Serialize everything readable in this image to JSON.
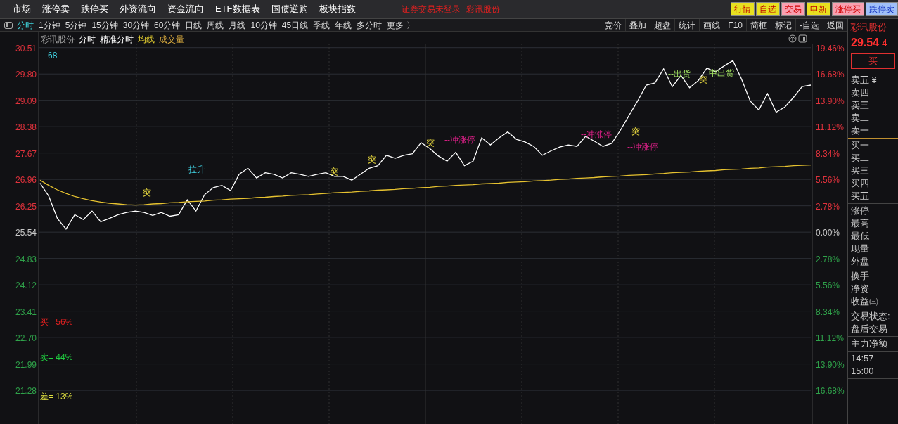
{
  "menu_bar": {
    "items": [
      "市场",
      "涨停卖",
      "跌停买",
      "外资流向",
      "资金流向",
      "ETF数据表",
      "国债逆购",
      "板块指数"
    ],
    "status_texts": [
      "证券交易未登录",
      "彩讯股份"
    ],
    "quick_buttons": [
      {
        "label": "行情",
        "kind": "yellow"
      },
      {
        "label": "自选",
        "kind": "yellow"
      },
      {
        "label": "交易",
        "kind": "pink"
      },
      {
        "label": "申新",
        "kind": "yellow"
      },
      {
        "label": "涨停买",
        "kind": "pink"
      },
      {
        "label": "跌停卖",
        "kind": "blue"
      }
    ]
  },
  "toolbar": {
    "periods": [
      {
        "label": "分时",
        "selected": true
      },
      {
        "label": "1分钟",
        "selected": false
      },
      {
        "label": "5分钟",
        "selected": false
      },
      {
        "label": "15分钟",
        "selected": false
      },
      {
        "label": "30分钟",
        "selected": false
      },
      {
        "label": "60分钟",
        "selected": false
      },
      {
        "label": "日线",
        "selected": false
      },
      {
        "label": "周线",
        "selected": false
      },
      {
        "label": "月线",
        "selected": false
      },
      {
        "label": "10分钟",
        "selected": false
      },
      {
        "label": "45日线",
        "selected": false
      },
      {
        "label": "季线",
        "selected": false
      },
      {
        "label": "年线",
        "selected": false
      },
      {
        "label": "多分时",
        "selected": false
      },
      {
        "label": "更多 〉",
        "selected": false
      }
    ],
    "tools": [
      "竞价",
      "叠加",
      "超盘",
      "统计",
      "画线",
      "F10",
      "简框",
      "标记",
      "-自选",
      "返回"
    ]
  },
  "chart": {
    "stock_name": "彩讯股份",
    "header_extras": [
      "精准分时",
      "成交量"
    ],
    "indicator_value": "68",
    "right_labels": [
      "19.46%",
      "16.68%",
      "13.90%",
      "11.12%",
      "8.34%",
      "5.56%",
      "2.78%",
      "0.00%",
      "2.78%",
      "5.56%",
      "8.34%",
      "11.12%",
      "13.90%",
      "16.68%"
    ],
    "stats": [
      {
        "text": "买= 56%",
        "kind": "buy"
      },
      {
        "text": "卖= 44%",
        "kind": "sell"
      },
      {
        "text": "差= 13%",
        "kind": "diff"
      }
    ],
    "markers": [
      {
        "text": "突",
        "kind": "breakout"
      },
      {
        "text": "拉升",
        "kind": "pull"
      },
      {
        "text": "突",
        "kind": "breakout"
      },
      {
        "text": "突",
        "kind": "breakout"
      },
      {
        "text": "突",
        "kind": "breakout"
      },
      {
        "text": "--冲涨停",
        "kind": "limit"
      },
      {
        "text": "--冲涨停",
        "kind": "limit"
      },
      {
        "text": "--冲涨停",
        "kind": "limit"
      },
      {
        "text": "突",
        "kind": "breakout"
      },
      {
        "text": "--出货",
        "kind": "sell"
      },
      {
        "text": "突",
        "kind": "breakout"
      },
      {
        "text": "中出货",
        "kind": "sell"
      }
    ],
    "chart_data": {
      "type": "line",
      "ylim": [
        20.43,
        30.94
      ],
      "grid": true,
      "categories": [
        null,
        null,
        null,
        null,
        null,
        null,
        null,
        null,
        null,
        null,
        null,
        null,
        null,
        null,
        null,
        null,
        null,
        null,
        null,
        null,
        null,
        null,
        null,
        null,
        null,
        null,
        null,
        null,
        null,
        null,
        null,
        null,
        null,
        null,
        null,
        null,
        null,
        null,
        null,
        null,
        null,
        null,
        null,
        null,
        null,
        null,
        null,
        null,
        null,
        null,
        null,
        null,
        null,
        null,
        null,
        null,
        null,
        null,
        null,
        null,
        null,
        null,
        null,
        null,
        null,
        null,
        null,
        null,
        null,
        null,
        null,
        null,
        null,
        null,
        null,
        null,
        null,
        null,
        null,
        null,
        null,
        null,
        null,
        null,
        null,
        null,
        null,
        null,
        null,
        null
      ],
      "yticks": [
        {
          "value": 30.51,
          "label": "30.51"
        },
        {
          "value": 29.8,
          "label": "29.80"
        },
        {
          "value": 29.09,
          "label": "29.09"
        },
        {
          "value": 28.38,
          "label": "28.38"
        },
        {
          "value": 27.67,
          "label": "27.67"
        },
        {
          "value": 26.96,
          "label": "26.96"
        },
        {
          "value": 26.25,
          "label": "26.25"
        },
        {
          "value": 25.54,
          "label": "25.54"
        },
        {
          "value": 24.83,
          "label": "24.83"
        },
        {
          "value": 24.12,
          "label": "24.12"
        },
        {
          "value": 23.41,
          "label": "23.41"
        },
        {
          "value": 22.7,
          "label": "22.70"
        },
        {
          "value": 21.99,
          "label": "21.99"
        },
        {
          "value": 21.28,
          "label": "21.28"
        }
      ],
      "series": [
        {
          "name": "分时",
          "color": "#ffffff",
          "values": [
            26.86,
            26.51,
            25.91,
            25.62,
            26.01,
            25.88,
            26.11,
            25.82,
            25.91,
            26.01,
            26.07,
            26.11,
            26.07,
            25.99,
            26.07,
            25.97,
            26.01,
            26.41,
            26.11,
            26.55,
            26.74,
            26.8,
            26.66,
            27.1,
            27.26,
            27.0,
            27.14,
            27.1,
            27.0,
            27.14,
            27.1,
            27.04,
            27.1,
            27.14,
            27.04,
            27.04,
            26.94,
            27.1,
            27.26,
            27.33,
            27.61,
            27.53,
            27.61,
            27.65,
            27.95,
            27.79,
            27.59,
            27.45,
            27.69,
            27.33,
            27.45,
            28.08,
            27.89,
            28.08,
            28.24,
            28.04,
            27.97,
            27.85,
            27.61,
            27.73,
            27.83,
            27.89,
            27.85,
            28.12,
            27.99,
            27.85,
            27.93,
            28.28,
            28.68,
            29.07,
            29.5,
            29.56,
            29.94,
            29.46,
            29.76,
            29.43,
            29.62,
            29.96,
            29.86,
            30.02,
            30.16,
            29.66,
            29.07,
            28.83,
            29.27,
            28.77,
            28.91,
            29.17,
            29.46,
            29.5
          ]
        },
        {
          "name": "均线",
          "color": "#e6c230",
          "values": [
            26.94,
            26.8,
            26.68,
            26.58,
            26.5,
            26.44,
            26.39,
            26.35,
            26.32,
            26.3,
            26.28,
            26.27,
            26.28,
            26.3,
            26.31,
            26.33,
            26.34,
            26.36,
            26.37,
            26.38,
            26.4,
            26.41,
            26.43,
            26.44,
            26.45,
            26.47,
            26.48,
            26.5,
            26.51,
            26.53,
            26.54,
            26.55,
            26.57,
            26.58,
            26.6,
            26.61,
            26.62,
            26.64,
            26.65,
            26.67,
            26.68,
            26.69,
            26.71,
            26.72,
            26.74,
            26.75,
            26.77,
            26.78,
            26.8,
            26.81,
            26.82,
            26.84,
            26.85,
            26.86,
            26.88,
            26.89,
            26.9,
            26.92,
            26.93,
            26.94,
            26.96,
            26.97,
            26.99,
            27.0,
            27.01,
            27.03,
            27.04,
            27.05,
            27.07,
            27.08,
            27.09,
            27.11,
            27.12,
            27.14,
            27.15,
            27.16,
            27.18,
            27.19,
            27.2,
            27.22,
            27.23,
            27.24,
            27.26,
            27.27,
            27.29,
            27.3,
            27.31,
            27.33,
            27.34,
            27.35
          ]
        }
      ]
    }
  },
  "quote_panel": {
    "title": "彩讯股份",
    "price": "29.54",
    "price_tail": "4",
    "buy_button": "买",
    "groups": [
      [
        "卖五 ¥",
        "卖四",
        "卖三",
        "卖二",
        "卖一"
      ],
      [
        "买一",
        "买二",
        "买三",
        "买四",
        "买五"
      ],
      [
        "涨停",
        "最高",
        "最低",
        "现量",
        "外盘"
      ],
      [
        "换手",
        "净资",
        "收益㈢"
      ],
      [
        "交易状态:",
        "盘后交易"
      ],
      [
        "主力净额"
      ],
      [
        "14:57",
        "15:00"
      ]
    ]
  }
}
